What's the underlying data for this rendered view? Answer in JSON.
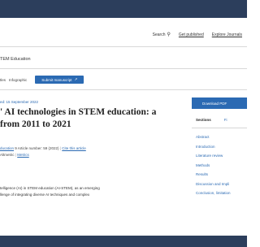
{
  "header": {
    "nav": {
      "search_label": "Search",
      "get_published_label": "Get published",
      "explore_journals_label": "Explore Journals"
    }
  },
  "journal": {
    "name": "TEM Education"
  },
  "subnav": {
    "items": [
      "tles",
      "Infographic"
    ],
    "submit_label": "Submit manuscript"
  },
  "article": {
    "date_text": "ed: 15 September 2022",
    "title_line1": "' AI technologies in STEM education: a",
    "title_line2": "from 2011 to 2021",
    "cite_prefix": "ducation",
    "article_number": "9  Article number: 59 (2022)",
    "cite_link": "Cite this article",
    "metrics_text": "Altmetric",
    "metrics_link": "Metrics",
    "abstract_line1": "telligence (AI) in STEM education (AI-STEM), as an emerging",
    "abstract_line2": "llenge of integrating diverse AI techniques and complex"
  },
  "sidebar": {
    "download_label": "Download PDF",
    "tabs": [
      {
        "label": "Sections",
        "active": true
      },
      {
        "label": "Fi",
        "active": false
      }
    ],
    "sections": [
      "Abstract",
      "Introduction",
      "Literature review",
      "Methods",
      "Results",
      "Discussion and Impli",
      "Conclusion, limitation"
    ]
  },
  "colors": {
    "brand_dark": "#2c3e5c",
    "accent_blue": "#2b6ab3"
  }
}
